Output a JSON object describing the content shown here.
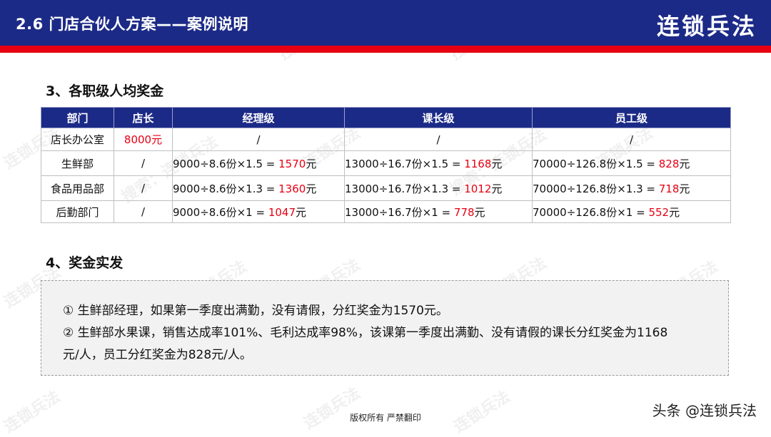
{
  "header": {
    "title": "2.6  门店合伙人方案——案例说明",
    "brand": "连锁兵法"
  },
  "section3": {
    "title": "3、各职级人均奖金"
  },
  "table": {
    "headers": [
      "部门",
      "店长",
      "经理级",
      "课长级",
      "员工级"
    ],
    "rows": [
      {
        "dept": "店长办公室",
        "manager": "8000元",
        "cells": [
          {
            "pre": "/",
            "val": "",
            "suf": ""
          },
          {
            "pre": "/",
            "val": "",
            "suf": ""
          },
          {
            "pre": "/",
            "val": "",
            "suf": ""
          }
        ]
      },
      {
        "dept": "生鲜部",
        "manager": "/",
        "cells": [
          {
            "pre": "9000÷8.6份×1.5 = ",
            "val": "1570",
            "suf": "元"
          },
          {
            "pre": "13000÷16.7份×1.5 = ",
            "val": "1168",
            "suf": "元"
          },
          {
            "pre": "70000÷126.8份×1.5 = ",
            "val": "828",
            "suf": "元"
          }
        ]
      },
      {
        "dept": "食品用品部",
        "manager": "/",
        "cells": [
          {
            "pre": "9000÷8.6份×1.3 = ",
            "val": "1360",
            "suf": "元"
          },
          {
            "pre": "13000÷16.7份×1.3 = ",
            "val": "1012",
            "suf": "元"
          },
          {
            "pre": "70000÷126.8份×1.3 = ",
            "val": "718",
            "suf": "元"
          }
        ]
      },
      {
        "dept": "后勤部门",
        "manager": "/",
        "cells": [
          {
            "pre": "9000÷8.6份×1 = ",
            "val": "1047",
            "suf": "元"
          },
          {
            "pre": "13000÷16.7份×1 = ",
            "val": "778",
            "suf": "元"
          },
          {
            "pre": "70000÷126.8份×1 = ",
            "val": "552",
            "suf": "元"
          }
        ]
      }
    ]
  },
  "section4": {
    "title": "4、奖金实发",
    "lines": [
      "① 生鲜部经理，如果第一季度出满勤，没有请假，分红奖金为1570元。",
      "② 生鲜部水果课，销售达成率101%、毛利达成率98%，该课第一季度出满勤、没有请假的课长分红奖金为1168",
      "元/人，员工分红奖金为828元/人。"
    ]
  },
  "footer": {
    "copyright": "版权所有  严禁翻印",
    "signature": "头条 @连锁兵法"
  },
  "watermark": {
    "text_a": "连锁兵法",
    "text_b": "搜索：连锁兵法"
  },
  "colors": {
    "header_blue": "#1c2a87",
    "accent_red": "#e60012"
  }
}
